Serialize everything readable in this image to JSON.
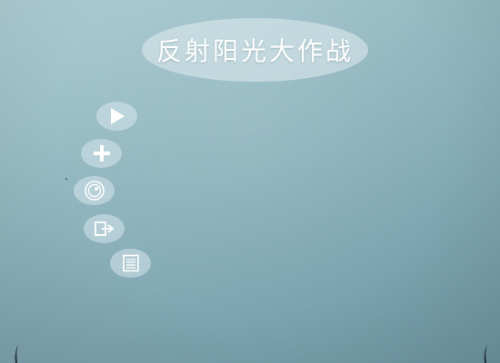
{
  "game": {
    "title": "反射阳光大作战"
  },
  "menu": {
    "buttons": [
      {
        "id": "play",
        "icon": "play-icon"
      },
      {
        "id": "add",
        "icon": "plus-icon"
      },
      {
        "id": "target",
        "icon": "target-icon"
      },
      {
        "id": "exit",
        "icon": "exit-icon"
      },
      {
        "id": "list",
        "icon": "list-icon"
      }
    ]
  },
  "colors": {
    "background_top": "#aecdd4",
    "background_bottom": "#6f97a4",
    "button_fill": "#d7e6ec",
    "icon": "#ffffff"
  }
}
